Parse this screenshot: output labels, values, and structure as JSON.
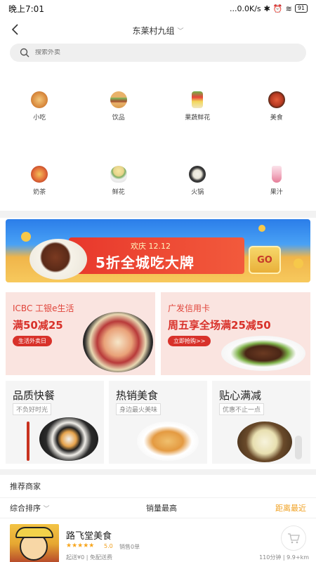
{
  "status_bar": {
    "time": "晚上7:01",
    "network": "...0.0K/s",
    "battery": "91"
  },
  "header": {
    "location": "东莱村九组"
  },
  "search": {
    "placeholder": "搜索外卖"
  },
  "categories": [
    {
      "label": "小吃",
      "icon": "snack-icon",
      "color": "#e7954a"
    },
    {
      "label": "饮品",
      "icon": "burger-icon",
      "color": "#e8a64a"
    },
    {
      "label": "果蔬鲜花",
      "icon": "fruit-cup-icon",
      "color": "#e2c25a"
    },
    {
      "label": "美食",
      "icon": "hotpot-bowl-icon",
      "color": "#c94a32"
    },
    {
      "label": "奶茶",
      "icon": "pizza-icon",
      "color": "#e6713a"
    },
    {
      "label": "鲜花",
      "icon": "noodle-bowl-icon",
      "color": "#e8e0bf"
    },
    {
      "label": "火锅",
      "icon": "dumpling-icon",
      "color": "#3a3a3a"
    },
    {
      "label": "果汁",
      "icon": "juice-icon",
      "color": "#e8b0c0"
    }
  ],
  "banner": {
    "subtitle": "欢庆 12.12",
    "title": "5折全城吃大牌",
    "cta": "GO"
  },
  "promos": [
    {
      "brand": "ICBC 工银e生活",
      "title": "满50减25",
      "tag": "生活外卖日"
    },
    {
      "brand": "广发信用卡",
      "title": "周五享全场满25减50",
      "tag": "立即抢购>>"
    }
  ],
  "feature_cards": [
    {
      "title": "品质快餐",
      "subtitle": "不负好时光"
    },
    {
      "title": "热销美食",
      "subtitle": "身边最火美味"
    },
    {
      "title": "贴心满减",
      "subtitle": "优惠不止一点"
    }
  ],
  "recommend": {
    "title": "推荐商家",
    "sort": {
      "comprehensive": "综合排序",
      "sales": "销量最高",
      "distance": "距离最近"
    }
  },
  "shop": {
    "name": "路飞堂美食",
    "stars": "★★★★★",
    "rating": "5.0",
    "sales": "销售0单",
    "delivery": "起送¥0 | 免配送费",
    "eta": "110分钟 | 9.9+km"
  },
  "colors": {
    "accent": "#f0a020",
    "promo_red": "#d8312a"
  }
}
